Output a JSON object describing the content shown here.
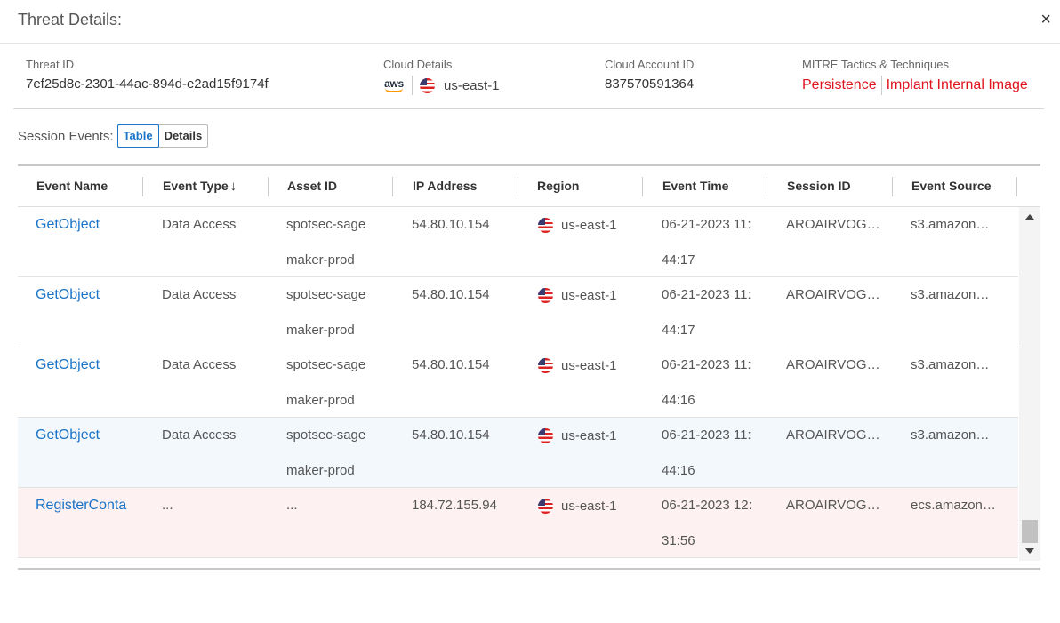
{
  "dialog": {
    "title": "Threat Details:",
    "close_glyph": "×"
  },
  "info": {
    "threat_id_label": "Threat ID",
    "threat_id": "7ef25d8c-2301-44ac-894d-e2ad15f9174f",
    "cloud_label": "Cloud Details",
    "cloud_provider_logo": "aws",
    "cloud_region": "us-east-1",
    "account_label": "Cloud Account ID",
    "account_id": "837570591364",
    "mitre_label": "MITRE Tactics & Techniques",
    "mitre_tactic": "Persistence",
    "mitre_technique": "Implant Internal Image"
  },
  "session": {
    "label": "Session Events:",
    "tab_table": "Table",
    "tab_details": "Details",
    "active_tab": "Table"
  },
  "table": {
    "headers": [
      "Event Name",
      "Event Type",
      "Asset ID",
      "IP Address",
      "Region",
      "Event Time",
      "Session ID",
      "Event Source"
    ],
    "sort_arrow": "↓",
    "rows": [
      {
        "name": "GetObject",
        "type": "Data Access",
        "asset1": "spotsec-sage",
        "asset2": "maker-prod",
        "ip": "54.80.10.154",
        "region": "us-east-1",
        "time1": "06-21-2023 11:",
        "time2": "44:17",
        "session": "AROAIRVOG…",
        "source": "s3.amazon…",
        "state": "normal"
      },
      {
        "name": "GetObject",
        "type": "Data Access",
        "asset1": "spotsec-sage",
        "asset2": "maker-prod",
        "ip": "54.80.10.154",
        "region": "us-east-1",
        "time1": "06-21-2023 11:",
        "time2": "44:17",
        "session": "AROAIRVOG…",
        "source": "s3.amazon…",
        "state": "normal"
      },
      {
        "name": "GetObject",
        "type": "Data Access",
        "asset1": "spotsec-sage",
        "asset2": "maker-prod",
        "ip": "54.80.10.154",
        "region": "us-east-1",
        "time1": "06-21-2023 11:",
        "time2": "44:16",
        "session": "AROAIRVOG…",
        "source": "s3.amazon…",
        "state": "normal"
      },
      {
        "name": "GetObject",
        "type": "Data Access",
        "asset1": "spotsec-sage",
        "asset2": "maker-prod",
        "ip": "54.80.10.154",
        "region": "us-east-1",
        "time1": "06-21-2023 11:",
        "time2": "44:16",
        "session": "AROAIRVOG…",
        "source": "s3.amazon…",
        "state": "hover"
      },
      {
        "name": "RegisterConta",
        "type": "...",
        "asset1": "...",
        "asset2": "",
        "ip": "184.72.155.94",
        "region": "us-east-1",
        "time1": "06-21-2023 12:",
        "time2": "31:56",
        "session": "AROAIRVOG…",
        "source": "ecs.amazon…",
        "state": "alert"
      }
    ]
  },
  "colors": {
    "link": "#1a73c7",
    "mitre": "#e0141e",
    "row_hover": "#f3f8fd",
    "row_alert": "#fdf1f1"
  }
}
